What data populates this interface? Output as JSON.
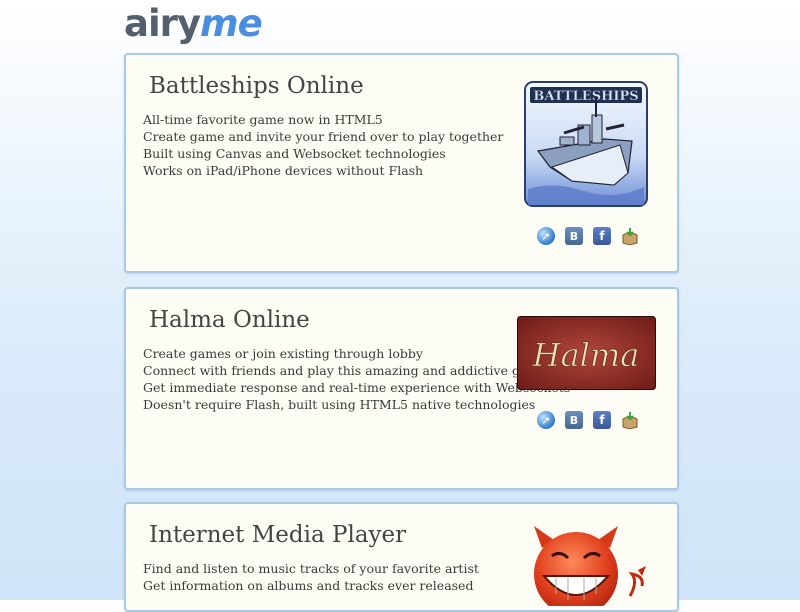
{
  "logo": {
    "part1": "airy",
    "part2": "me"
  },
  "projects": [
    {
      "title": "Battleships Online",
      "image_text": "BATTLESHIPS",
      "lines": [
        "All-time favorite game now in HTML5",
        "Create game and invite your friend over to play together",
        "Built using Canvas and Websocket technologies",
        "Works on iPad/iPhone devices without Flash"
      ],
      "links": [
        "website-icon",
        "vkontakte-icon",
        "facebook-icon",
        "download-box-icon"
      ]
    },
    {
      "title": "Halma Online",
      "image_text": "Halma",
      "lines": [
        "Create games or join existing through lobby",
        "Connect with friends and play this amazing and addictive game",
        "Get immediate response and real-time experience with Websockets",
        "Doesn't require Flash, built using HTML5 native technologies"
      ],
      "links": [
        "website-icon",
        "vkontakte-icon",
        "facebook-icon",
        "download-box-icon"
      ]
    },
    {
      "title": "Internet Media Player",
      "lines": [
        "Find and listen to music tracks of your favorite artist",
        "Get information on albums and tracks ever released"
      ]
    }
  ],
  "icon_glyphs": {
    "vk": "B",
    "fb": "f"
  },
  "colors": {
    "border": "#a9c9e6",
    "card_bg": "#fdfdf6",
    "logo_grey": "#55606e",
    "logo_blue": "#4a8ee0"
  }
}
